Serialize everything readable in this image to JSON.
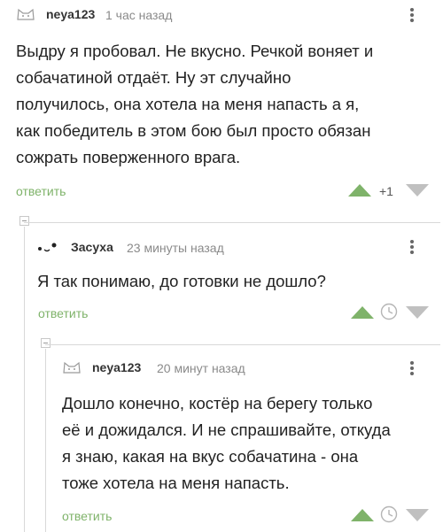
{
  "colors": {
    "accent": "#7fb36a",
    "vote_down": "#c0c0c0",
    "thread_line": "#d8d8d8"
  },
  "comments": [
    {
      "author": "neya123",
      "time": "1 час назад",
      "avatar_icon": "cat-avatar-icon",
      "text": "Выдру я пробовал. Не вкусно. Речкой воняет и\nсобачатиной отдаёт. Ну эт случайно\nполучилось, она хотела на меня напасть а я,\nкак победитель в этом бою был просто обязан\nсожрать поверженного врага.",
      "reply_label": "ответить",
      "rating": "+1"
    },
    {
      "author": "Засуха",
      "time": "23 минуты назад",
      "avatar_icon": "face-avatar-icon",
      "text": "Я так понимаю, до готовки не дошло?",
      "reply_label": "ответить",
      "rating_icon": "clock-icon"
    },
    {
      "author": "neya123",
      "time": "20 минут назад",
      "avatar_icon": "cat-avatar-icon",
      "text": "Дошло конечно, костёр на берегу только\nеё и дожидался. И не спрашивайте, откуда\nя знаю, какая на вкус собачатина - она\nтоже хотела на меня напасть.",
      "reply_label": "ответить",
      "rating_icon": "clock-icon"
    }
  ]
}
